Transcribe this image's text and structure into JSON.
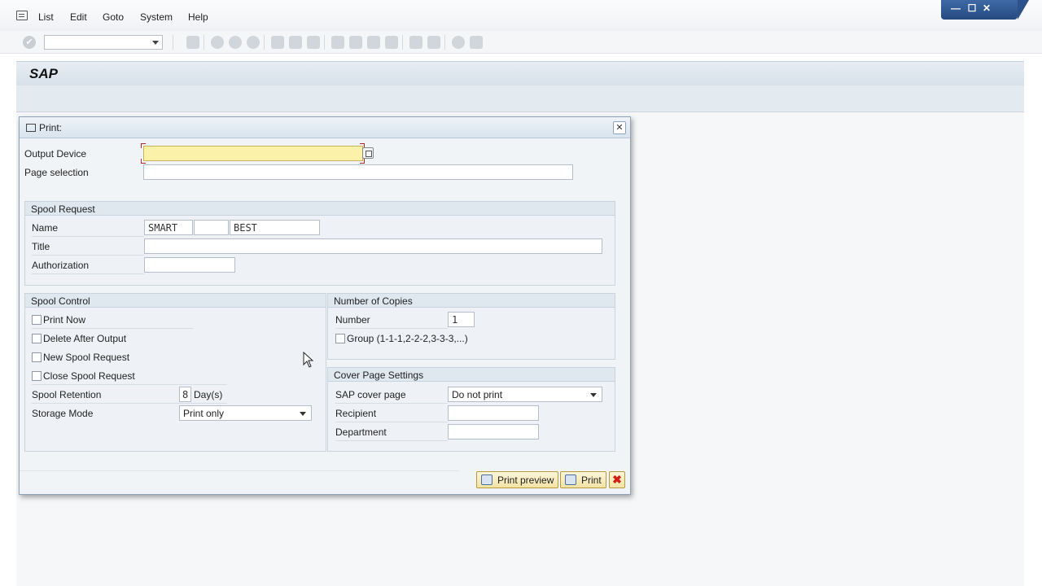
{
  "menu": {
    "items": [
      "List",
      "Edit",
      "Goto",
      "System",
      "Help"
    ]
  },
  "window_controls": {
    "minimize": "—",
    "maximize": "☐",
    "close": "✕"
  },
  "toolbar": {
    "command_field": "",
    "check_icon": "✔"
  },
  "header": {
    "title": "SAP"
  },
  "dialog": {
    "title": "Print:",
    "close": "✕",
    "output_device": {
      "label": "Output Device",
      "value": ""
    },
    "page_selection": {
      "label": "Page selection",
      "value": ""
    },
    "spool_request": {
      "title": "Spool Request",
      "name_label": "Name",
      "name_part1": "SMART",
      "name_part2": "",
      "name_part3": "BEST",
      "title_label": "Title",
      "title_value": "",
      "authorization_label": "Authorization",
      "authorization_value": ""
    },
    "spool_control": {
      "title": "Spool Control",
      "print_now": "Print Now",
      "delete_after_output": "Delete After Output",
      "new_spool_request": "New Spool Request",
      "close_spool_request": "Close Spool Request",
      "retention_label": "Spool Retention",
      "retention_value": "8",
      "retention_unit": "Day(s)",
      "storage_mode_label": "Storage Mode",
      "storage_mode_value": "Print only"
    },
    "copies": {
      "title": "Number of Copies",
      "number_label": "Number",
      "number_value": "1",
      "group_label": "Group (1-1-1,2-2-2,3-3-3,...)"
    },
    "cover_page": {
      "title": "Cover Page Settings",
      "sap_cover_label": "SAP cover page",
      "sap_cover_value": "Do not print",
      "recipient_label": "Recipient",
      "recipient_value": "",
      "department_label": "Department",
      "department_value": ""
    },
    "buttons": {
      "print_preview": "Print preview",
      "print": "Print",
      "cancel": "✖"
    }
  }
}
